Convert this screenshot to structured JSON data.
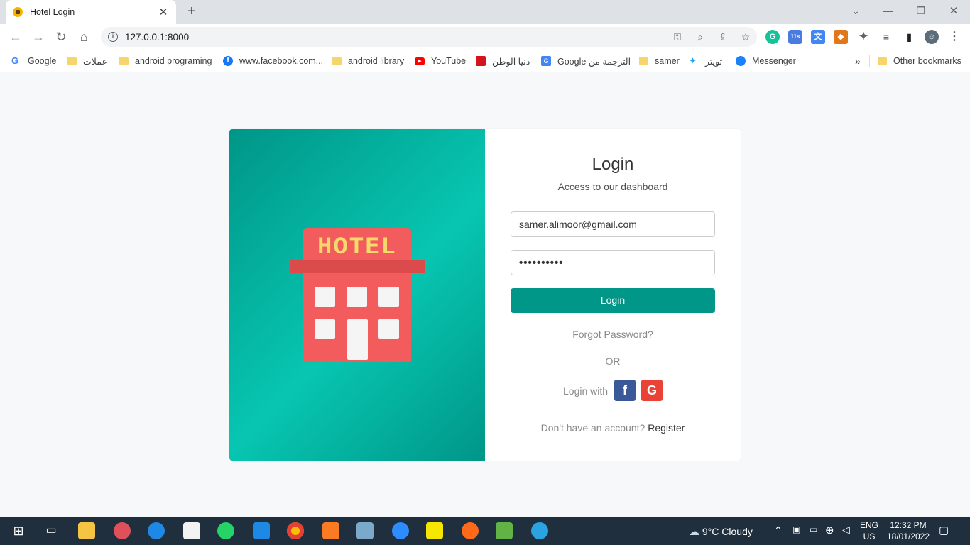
{
  "browser": {
    "tab_title": "Hotel Login",
    "url": "127.0.0.1:8000",
    "extension_badge": "11s",
    "bookmarks": [
      {
        "label": "Google",
        "icon": "google-icon"
      },
      {
        "label": "عملات",
        "icon": "folder-icon"
      },
      {
        "label": "android programing",
        "icon": "folder-icon"
      },
      {
        "label": "www.facebook.com...",
        "icon": "facebook-icon"
      },
      {
        "label": "android library",
        "icon": "folder-icon"
      },
      {
        "label": "YouTube",
        "icon": "youtube-icon"
      },
      {
        "label": "دنيا الوطن",
        "icon": "dunya-icon"
      },
      {
        "label": "Google الترجمة من",
        "icon": "translate-icon"
      },
      {
        "label": "samer",
        "icon": "folder-icon"
      },
      {
        "label": "تويتر",
        "icon": "twitter-icon"
      },
      {
        "label": "Messenger",
        "icon": "messenger-icon"
      }
    ],
    "bookmarks_more": "»",
    "other_bookmarks": "Other bookmarks"
  },
  "illustration": {
    "sign_text": "HOTEL"
  },
  "login": {
    "title": "Login",
    "subtitle": "Access to our dashboard",
    "email_value": "samer.alimoor@gmail.com",
    "password_value": "••••••••••",
    "button_label": "Login",
    "forgot_label": "Forgot Password?",
    "or_label": "OR",
    "login_with_label": "Login with",
    "facebook_glyph": "f",
    "google_glyph": "G",
    "no_account_text": "Don't have an account?",
    "register_label": "Register"
  },
  "taskbar": {
    "weather": "9°C  Cloudy",
    "language": "ENG",
    "region": "US",
    "time": "12:32 PM",
    "date": "18/01/2022"
  },
  "colors": {
    "accent": "#009688",
    "accent_light": "#07c6b1",
    "hotel_red": "#f25c5c",
    "hotel_sign_text": "#f7d96b",
    "facebook": "#3b5998",
    "google": "#ea4335"
  }
}
